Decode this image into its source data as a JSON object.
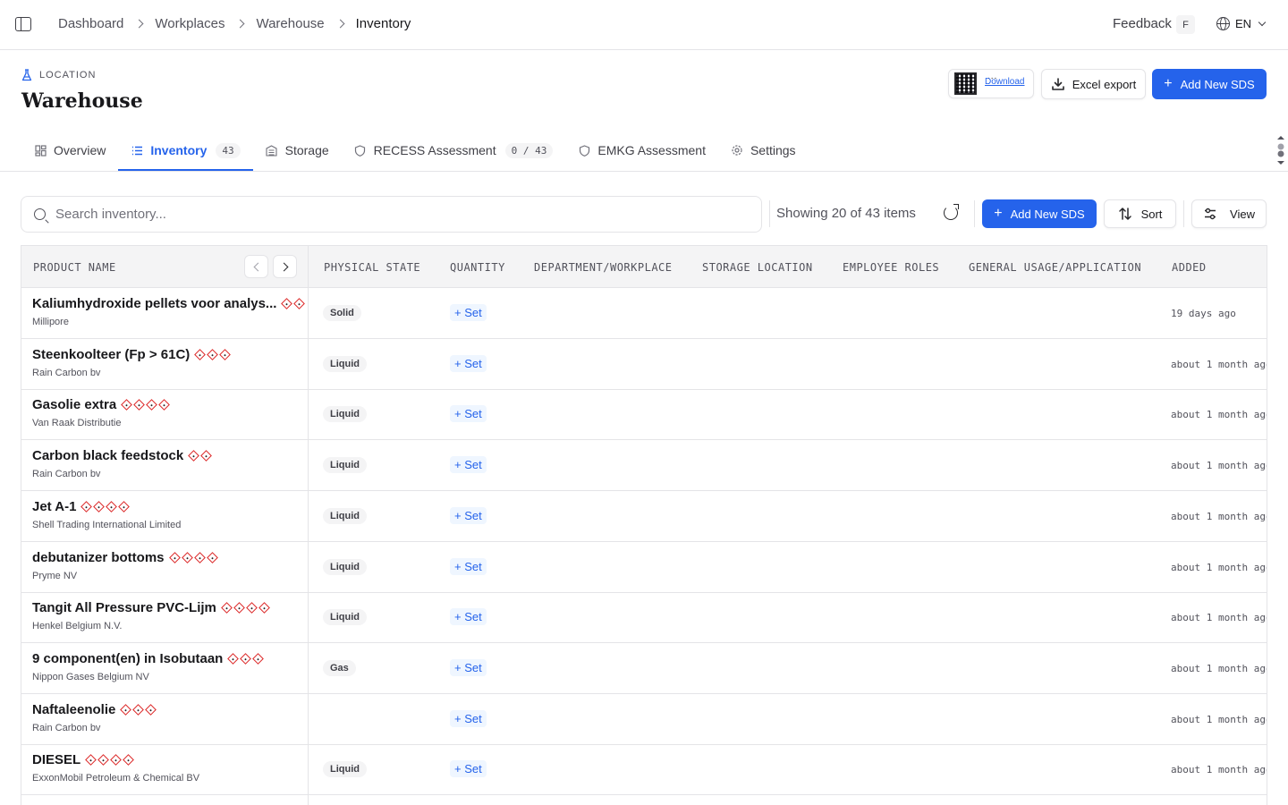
{
  "breadcrumb": [
    "Dashboard",
    "Workplaces",
    "Warehouse",
    "Inventory"
  ],
  "topbar": {
    "feedback": "Feedback",
    "feedback_key": "F",
    "language": "EN"
  },
  "header": {
    "label": "LOCATION",
    "title": "Warehouse",
    "qr_dots": "...",
    "qr_download": "Download",
    "excel_export": "Excel export",
    "add_new_sds": "Add New SDS"
  },
  "tabs": [
    {
      "label": "Overview",
      "icon": "grid-icon"
    },
    {
      "label": "Inventory",
      "icon": "list-icon",
      "badge": "43",
      "active": true
    },
    {
      "label": "Storage",
      "icon": "building-icon"
    },
    {
      "label": "RECESS Assessment",
      "icon": "shield-icon",
      "badge": "0 / 43"
    },
    {
      "label": "EMKG Assessment",
      "icon": "shield-icon"
    },
    {
      "label": "Settings",
      "icon": "gear-icon"
    }
  ],
  "toolbar": {
    "search_placeholder": "Search inventory...",
    "showing": "Showing 20 of 43 items",
    "add_new_sds": "Add New SDS",
    "sort": "Sort",
    "view": "View"
  },
  "table": {
    "columns": [
      "PRODUCT NAME",
      "PHYSICAL STATE",
      "QUANTITY",
      "DEPARTMENT/WORKPLACE",
      "STORAGE LOCATION",
      "EMPLOYEE ROLES",
      "GENERAL USAGE/APPLICATION",
      "ADDED"
    ],
    "set_label": "+ Set",
    "rows": [
      {
        "name": "Kaliumhydroxide pellets voor analys...",
        "supplier": "Millipore",
        "state": "Solid",
        "added": "19 days ago",
        "ghs": 2
      },
      {
        "name": "Steenkoolteer (Fp > 61C)",
        "supplier": "Rain Carbon bv",
        "state": "Liquid",
        "added": "about 1 month ago",
        "ghs": 3
      },
      {
        "name": "Gasolie extra",
        "supplier": "Van Raak Distributie",
        "state": "Liquid",
        "added": "about 1 month ago",
        "ghs": 4
      },
      {
        "name": "Carbon black feedstock",
        "supplier": "Rain Carbon bv",
        "state": "Liquid",
        "added": "about 1 month ago",
        "ghs": 2
      },
      {
        "name": "Jet A-1",
        "supplier": "Shell Trading International Limited",
        "state": "Liquid",
        "added": "about 1 month ago",
        "ghs": 4
      },
      {
        "name": "debutanizer bottoms",
        "supplier": "Pryme NV",
        "state": "Liquid",
        "added": "about 1 month ago",
        "ghs": 4
      },
      {
        "name": "Tangit All Pressure PVC-Lijm",
        "supplier": "Henkel Belgium N.V.",
        "state": "Liquid",
        "added": "about 1 month ago",
        "ghs": 4
      },
      {
        "name": "9 component(en) in Isobutaan",
        "supplier": "Nippon Gases Belgium NV",
        "state": "Gas",
        "added": "about 1 month ago",
        "ghs": 3
      },
      {
        "name": "Naftaleenolie",
        "supplier": "Rain Carbon bv",
        "state": "",
        "added": "about 1 month ago",
        "ghs": 3
      },
      {
        "name": "DIESEL",
        "supplier": "ExxonMobil Petroleum & Chemical BV",
        "state": "Liquid",
        "added": "about 1 month ago",
        "ghs": 4
      }
    ]
  },
  "colors": {
    "primary": "#2563eb",
    "hazard": "#dc2626",
    "border": "#e4e4e7"
  }
}
